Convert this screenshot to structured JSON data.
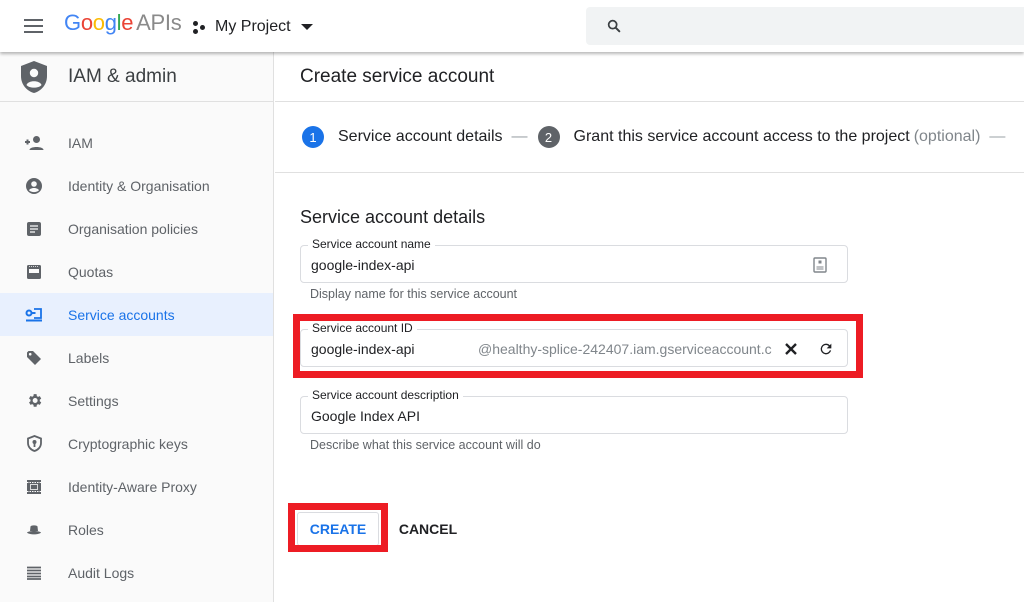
{
  "topbar": {
    "logo_google": [
      "G",
      "o",
      "o",
      "g",
      "l",
      "e"
    ],
    "logo_suffix": "APIs",
    "project_name": "My Project",
    "search_placeholder": ""
  },
  "sidebar": {
    "title": "IAM & admin",
    "items": [
      {
        "label": "IAM",
        "icon": "person-add-icon",
        "active": false
      },
      {
        "label": "Identity & Organisation",
        "icon": "account-circle-icon",
        "active": false
      },
      {
        "label": "Organisation policies",
        "icon": "document-icon",
        "active": false
      },
      {
        "label": "Quotas",
        "icon": "quota-icon",
        "active": false
      },
      {
        "label": "Service accounts",
        "icon": "service-account-key-icon",
        "active": true
      },
      {
        "label": "Labels",
        "icon": "tag-icon",
        "active": false
      },
      {
        "label": "Settings",
        "icon": "gear-icon",
        "active": false
      },
      {
        "label": "Cryptographic keys",
        "icon": "key-shield-icon",
        "active": false
      },
      {
        "label": "Identity-Aware Proxy",
        "icon": "proxy-icon",
        "active": false
      },
      {
        "label": "Roles",
        "icon": "hat-icon",
        "active": false
      },
      {
        "label": "Audit Logs",
        "icon": "list-icon",
        "active": false
      }
    ]
  },
  "main": {
    "page_title": "Create service account",
    "steps": [
      {
        "number": "1",
        "label": "Service account details",
        "optional": "",
        "active": true
      },
      {
        "number": "2",
        "label": "Grant this service account access to the project",
        "optional": "(optional)",
        "active": false
      }
    ],
    "step_separator": "—",
    "section_title": "Service account details",
    "fields": {
      "name": {
        "label": "Service account name",
        "value": "google-index-api",
        "hint": "Display name for this service account"
      },
      "id": {
        "label": "Service account ID",
        "value": "google-index-api",
        "suffix": "@healthy-splice-242407.iam.gserviceaccount.c"
      },
      "description": {
        "label": "Service account description",
        "value": "Google Index API",
        "hint": "Describe what this service account will do"
      }
    },
    "buttons": {
      "create": "CREATE",
      "cancel": "CANCEL"
    }
  },
  "colors": {
    "accent": "#1a73e8",
    "highlight": "#ed1c24",
    "active_nav_bg": "#e8f0fe"
  }
}
